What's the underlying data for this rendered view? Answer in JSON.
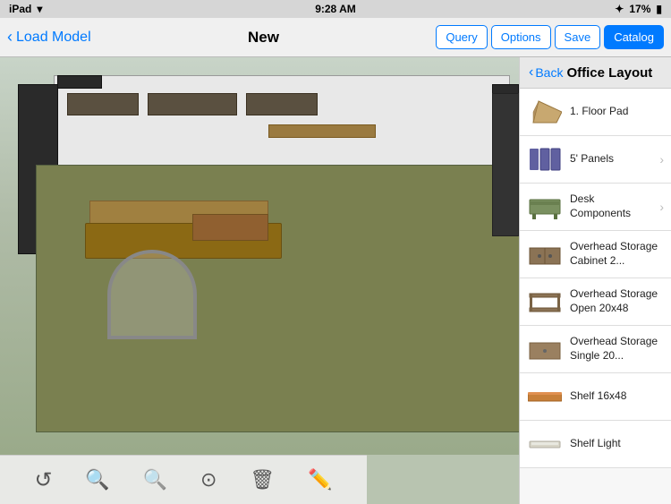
{
  "statusBar": {
    "carrier": "iPad",
    "wifi": "wifi",
    "time": "9:28 AM",
    "bluetooth": "BT",
    "batteryPercent": "17%",
    "batteryIcon": "battery"
  },
  "toolbar": {
    "loadModelLabel": "Load Model",
    "newLabel": "New",
    "queryLabel": "Query",
    "optionsLabel": "Options",
    "saveLabel": "Save",
    "catalogLabel": "Catalog"
  },
  "panel": {
    "backLabel": "Back",
    "title": "Office Layout",
    "items": [
      {
        "id": "floor-pad",
        "label": "1. Floor Pad",
        "hasChevron": false,
        "iconType": "floor-pad"
      },
      {
        "id": "five-panels",
        "label": "5' Panels",
        "hasChevron": true,
        "iconType": "panels"
      },
      {
        "id": "desk-components",
        "label": "Desk Components",
        "hasChevron": true,
        "iconType": "desk"
      },
      {
        "id": "overhead-cabinet",
        "label": "Overhead Storage Cabinet 2...",
        "hasChevron": false,
        "iconType": "cabinet"
      },
      {
        "id": "overhead-open",
        "label": "Overhead Storage Open 20x48",
        "hasChevron": false,
        "iconType": "cabinet"
      },
      {
        "id": "overhead-single",
        "label": "Overhead Storage Single 20...",
        "hasChevron": false,
        "iconType": "cabinet"
      },
      {
        "id": "shelf-16x48",
        "label": "Shelf 16x48",
        "hasChevron": false,
        "iconType": "shelf"
      },
      {
        "id": "shelf-light",
        "label": "Shelf Light",
        "hasChevron": false,
        "iconType": "shelf-light"
      }
    ]
  },
  "bottomBar": {
    "buttons": [
      {
        "id": "orbit",
        "icon": "↺",
        "label": "orbit"
      },
      {
        "id": "zoom-in",
        "icon": "⊕",
        "label": "zoom-in"
      },
      {
        "id": "zoom-out",
        "icon": "⊖",
        "label": "zoom-out"
      },
      {
        "id": "pan",
        "icon": "⊙",
        "label": "pan"
      },
      {
        "id": "delete",
        "icon": "⊠",
        "label": "delete"
      },
      {
        "id": "edit",
        "icon": "✎",
        "label": "edit"
      }
    ]
  },
  "viewport": {
    "scene": "Back Office Layout 3D View"
  }
}
